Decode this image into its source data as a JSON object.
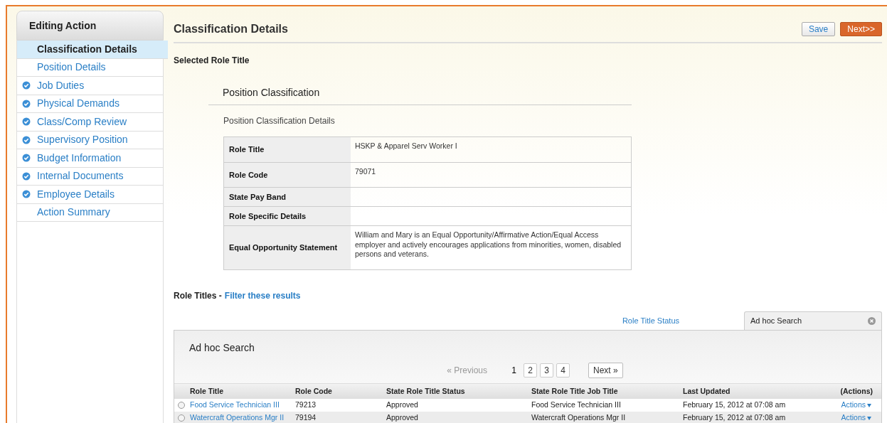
{
  "sidebar": {
    "title": "Editing Action",
    "items": [
      {
        "label": "Classification Details",
        "selected": true,
        "done": false
      },
      {
        "label": "Position Details",
        "selected": false,
        "done": false
      },
      {
        "label": "Job Duties",
        "selected": false,
        "done": true
      },
      {
        "label": "Physical Demands",
        "selected": false,
        "done": true
      },
      {
        "label": "Class/Comp Review",
        "selected": false,
        "done": true
      },
      {
        "label": "Supervisory Position",
        "selected": false,
        "done": true
      },
      {
        "label": "Budget Information",
        "selected": false,
        "done": true
      },
      {
        "label": "Internal Documents",
        "selected": false,
        "done": true
      },
      {
        "label": "Employee Details",
        "selected": false,
        "done": true
      },
      {
        "label": "Action Summary",
        "selected": false,
        "done": false
      }
    ]
  },
  "header": {
    "title": "Classification Details",
    "buttons": [
      {
        "label": "Save",
        "kind": "secondary"
      },
      {
        "label": "Next>>",
        "kind": "primary"
      }
    ]
  },
  "selected_role_title": {
    "heading": "Selected Role Title",
    "card_title": "Position Classification",
    "subtitle": "Position Classification Details",
    "fields": [
      {
        "label": "Role Title",
        "value": "HSKP & Apparel Serv Worker I"
      },
      {
        "label": "Role Code",
        "value": "79071"
      },
      {
        "label": "State Pay Band"
      },
      {
        "label": "Role Specific Details"
      },
      {
        "label": "Equal Opportunity Statement",
        "value": "William and Mary is an Equal Opportunity/Affirmative Action/Equal Access employer and actively encourages applications from minorities, women, disabled persons and veterans."
      }
    ]
  },
  "role_titles": {
    "heading": "Role Titles -",
    "filter_link": "Filter these results",
    "tabs": [
      {
        "label": "Role Title Status",
        "selected": false
      },
      {
        "label": "Ad hoc Search",
        "selected": true
      }
    ],
    "panel_title": "Ad hoc Search",
    "pagination": {
      "previous": {
        "label": "« Previous",
        "disabled": true
      },
      "pages": [
        {
          "label": "1",
          "selected": true
        },
        {
          "label": "2",
          "selected": false
        },
        {
          "label": "3",
          "selected": false
        },
        {
          "label": "4",
          "selected": false
        }
      ],
      "next": {
        "label": "Next »",
        "disabled": false
      }
    },
    "table": {
      "columns": [
        "Role Title",
        "Role Code",
        "State Role Title Status",
        "State Role Title Job Title",
        "Last Updated",
        "(Actions)"
      ],
      "rows": [
        {
          "selected": false,
          "role_title": "Food Service Technician III",
          "role_code": "79213",
          "status": "Approved",
          "job_title": "Food Service Technician III",
          "last_updated": "February 15, 2012 at 07:08 am",
          "action": "Actions"
        },
        {
          "selected": false,
          "role_title": "Watercraft Operations Mgr II",
          "role_code": "79194",
          "status": "Approved",
          "job_title": "Watercraft Operations Mgr II",
          "last_updated": "February 15, 2012 at 07:08 am",
          "action": "Actions"
        }
      ]
    }
  }
}
